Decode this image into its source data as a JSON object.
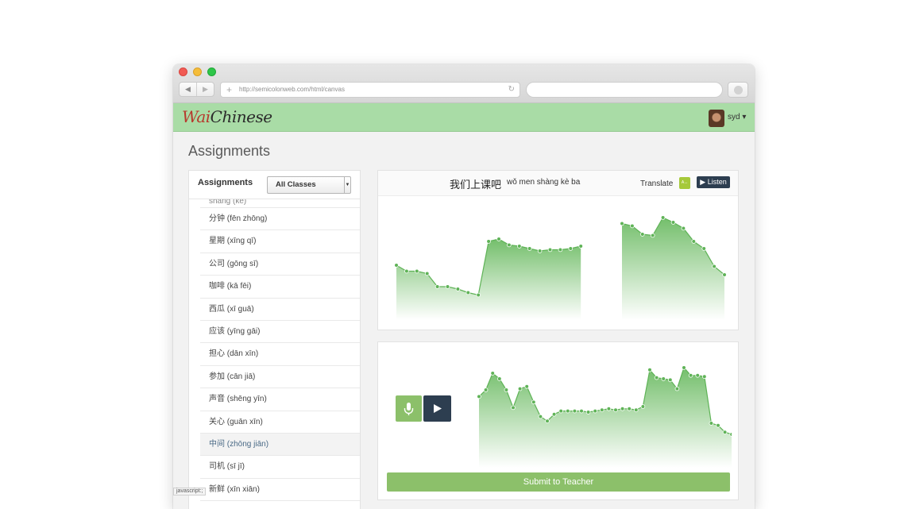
{
  "browser": {
    "url": "http://semicolonweb.com/html/canvas",
    "back_glyph": "◀",
    "forward_glyph": "▶",
    "plus_glyph": "+",
    "reload_glyph": "↻"
  },
  "app": {
    "logo_part1": "Wai",
    "logo_part2": "Chinese",
    "username": "syd ▾",
    "brand_color": "#a9dca6",
    "accent_green": "#8cc06a",
    "dark_button": "#2d3e50"
  },
  "page": {
    "title": "Assignments"
  },
  "sidebar": {
    "title": "Assignments",
    "class_filter": "All Classes",
    "items": [
      {
        "label": "shàng (kè)",
        "partial": true
      },
      {
        "label": "分钟 (fēn zhōng)"
      },
      {
        "label": "星期 (xīng qī)"
      },
      {
        "label": "公司 (gōng sī)"
      },
      {
        "label": "咖啡 (kā fēi)"
      },
      {
        "label": "西瓜 (xī guā)"
      },
      {
        "label": "应该 (yīng gāi)"
      },
      {
        "label": "担心 (dān xīn)"
      },
      {
        "label": "参加 (cān jiā)"
      },
      {
        "label": "声音 (shēng yīn)"
      },
      {
        "label": "关心 (guān xīn)"
      },
      {
        "label": "中间 (zhōng jiān)",
        "active": true
      },
      {
        "label": "司机 (sī jī)"
      },
      {
        "label": "新鲜 (xīn xiān)"
      }
    ]
  },
  "phrase": {
    "hanzi": "我们上课吧",
    "pinyin": "wǒ men shàng kè ba",
    "translate_label": "Translate",
    "translate_icon_text": "A↔",
    "listen_label": "▶ Listen"
  },
  "recording": {
    "submit_label": "Submit to Teacher"
  },
  "status_bar": "javascript:;",
  "chart_data": [
    {
      "type": "area",
      "series": [
        {
          "segments": [
            [
              0.46,
              0.41,
              0.41,
              0.39,
              0.28,
              0.28,
              0.26,
              0.23,
              0.21,
              0.66,
              0.68,
              0.63,
              0.62,
              0.6,
              0.58,
              0.59,
              0.59,
              0.6,
              0.62
            ],
            [
              0.81,
              0.79,
              0.72,
              0.71,
              0.86,
              0.82,
              0.77,
              0.66,
              0.6,
              0.45,
              0.38
            ]
          ]
        }
      ],
      "ylim": [
        0,
        1
      ],
      "grid": false
    },
    {
      "type": "area",
      "series": [
        {
          "values": [
            0.64,
            0.7,
            0.85,
            0.8,
            0.7,
            0.54,
            0.71,
            0.73,
            0.59,
            0.46,
            0.42,
            0.48,
            0.51,
            0.51,
            0.51,
            0.51,
            0.5,
            0.51,
            0.52,
            0.53,
            0.52,
            0.53,
            0.53,
            0.52,
            0.55,
            0.88,
            0.81,
            0.8,
            0.79,
            0.71,
            0.9,
            0.83,
            0.83,
            0.82,
            0.4,
            0.38,
            0.32,
            0.3
          ]
        }
      ],
      "ylim": [
        0,
        1
      ],
      "grid": false
    }
  ]
}
